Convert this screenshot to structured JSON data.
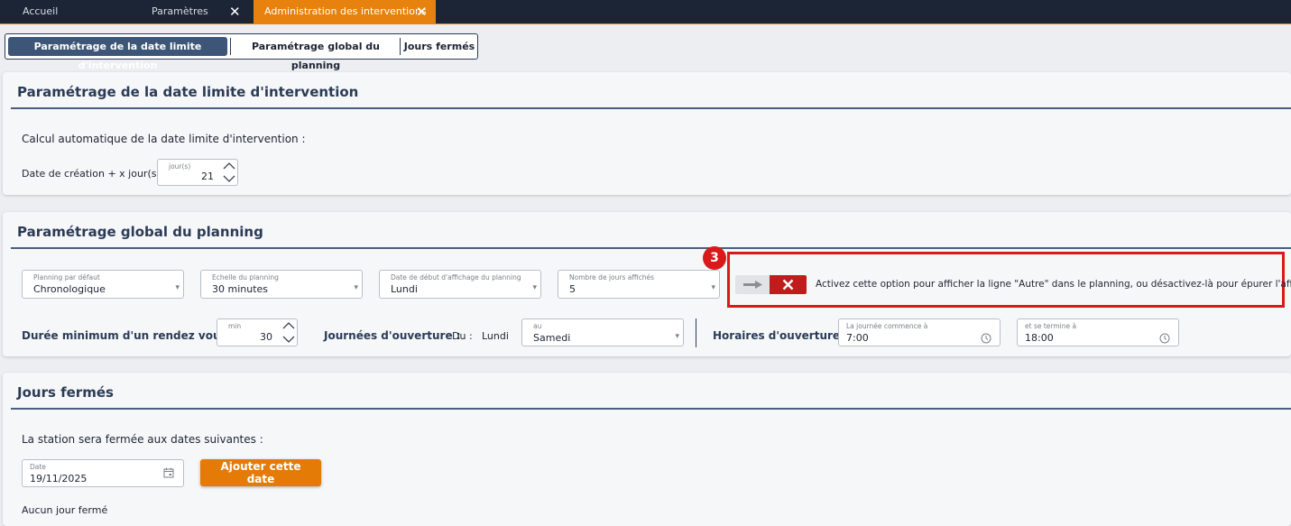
{
  "tabs": [
    {
      "label": "Accueil"
    },
    {
      "label": "Paramètres"
    },
    {
      "label": "Administration des interventions"
    }
  ],
  "subnav": {
    "items": [
      "Paramétrage de la date limite d'intervention",
      "Paramétrage global du planning",
      "Jours fermés"
    ]
  },
  "deadline": {
    "title": "Paramétrage de la date limite d'intervention",
    "auto_label": "Calcul automatique de la date limite d'intervention :",
    "creation_label": "Date de création + x jour(s)",
    "days_field_label": "jour(s)",
    "days_value": "21"
  },
  "planning": {
    "title": "Paramétrage global du planning",
    "default_view": {
      "label": "Planning par défaut",
      "value": "Chronologique"
    },
    "scale": {
      "label": "Echelle du planning",
      "value": "30 minutes"
    },
    "start_day": {
      "label": "Date de début d'affichage du planning",
      "value": "Lundi"
    },
    "days_shown": {
      "label": "Nombre de jours affichés",
      "value": "5"
    },
    "badge_number": "3",
    "toggle_description": "Activez cette option pour afficher la ligne \"Autre\" dans le planning, ou désactivez-là pour épurer l'affichage",
    "min_duration_label": "Durée minimum d'un rendez vous :",
    "min_unit": "min",
    "min_value": "30",
    "opening_days_label": "Journées d'ouverture :",
    "from_label": "Du :",
    "from_value": "Lundi",
    "to_field_label": "au",
    "to_value": "Samedi",
    "hours_label": "Horaires d'ouverture :",
    "start_hour": {
      "label": "La journée commence à",
      "value": "7:00"
    },
    "end_hour": {
      "label": "et se termine à",
      "value": "18:00"
    }
  },
  "closed": {
    "title": "Jours fermés",
    "intro": "La station sera fermée aux dates suivantes :",
    "date_field_label": "Date",
    "date_value": "19/11/2025",
    "add_button": "Ajouter cette date",
    "empty_text": "Aucun jour fermé"
  },
  "colors": {
    "navy": "#1b2535",
    "accent_orange": "#e8820e",
    "toggle_off_red": "#c11b1b",
    "highlight_red": "#d91a1a"
  },
  "icons": [
    "close-icon",
    "chevron-down-icon",
    "chevron-up-icon",
    "clock-icon",
    "calendar-icon",
    "arrow-right-icon",
    "x-icon"
  ]
}
